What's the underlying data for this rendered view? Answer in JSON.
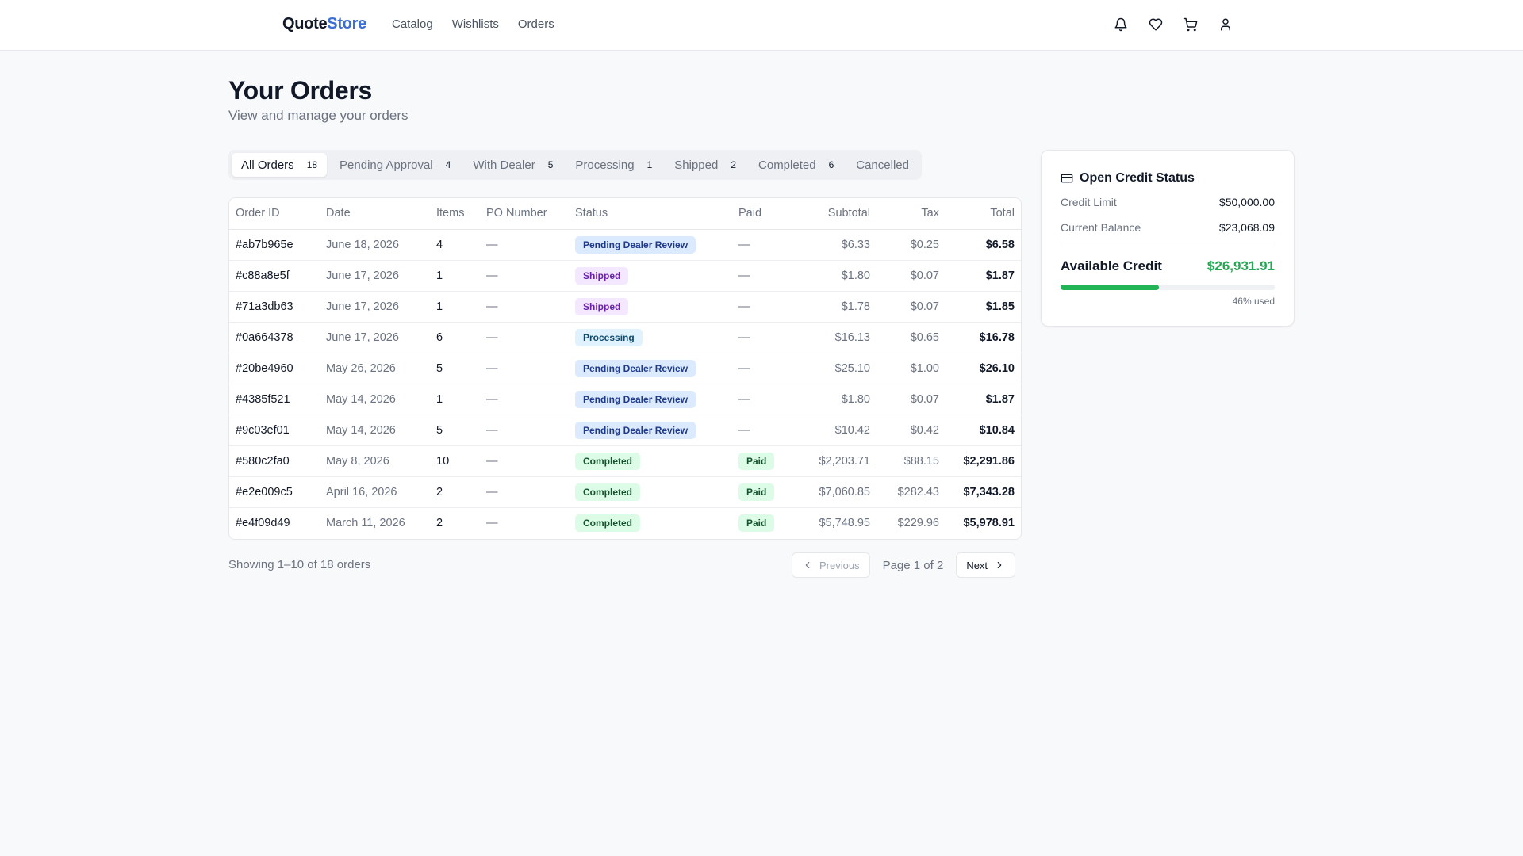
{
  "header": {
    "brand_part1": "Quote",
    "brand_part2": "Store",
    "nav": [
      "Catalog",
      "Wishlists",
      "Orders"
    ],
    "icons": [
      "bell-icon",
      "heart-icon",
      "cart-icon",
      "user-icon"
    ]
  },
  "page": {
    "title": "Your Orders",
    "subtitle": "View and manage your orders"
  },
  "tabs": [
    {
      "label": "All Orders",
      "count": "18",
      "active": true
    },
    {
      "label": "Pending Approval",
      "count": "4"
    },
    {
      "label": "With Dealer",
      "count": "5"
    },
    {
      "label": "Processing",
      "count": "1"
    },
    {
      "label": "Shipped",
      "count": "2"
    },
    {
      "label": "Completed",
      "count": "6"
    },
    {
      "label": "Cancelled",
      "count": ""
    }
  ],
  "table": {
    "columns": [
      "Order ID",
      "Date",
      "Items",
      "PO Number",
      "Status",
      "Paid",
      "Subtotal",
      "Tax",
      "Total"
    ],
    "rows": [
      {
        "id": "#ab7b965e",
        "date": "June 18, 2026",
        "items": "4",
        "po": "—",
        "status": "Pending Dealer Review",
        "status_kind": "pending",
        "paid": "—",
        "subtotal": "$6.33",
        "tax": "$0.25",
        "total": "$6.58"
      },
      {
        "id": "#c88a8e5f",
        "date": "June 17, 2026",
        "items": "1",
        "po": "—",
        "status": "Shipped",
        "status_kind": "shipped",
        "paid": "—",
        "subtotal": "$1.80",
        "tax": "$0.07",
        "total": "$1.87"
      },
      {
        "id": "#71a3db63",
        "date": "June 17, 2026",
        "items": "1",
        "po": "—",
        "status": "Shipped",
        "status_kind": "shipped",
        "paid": "—",
        "subtotal": "$1.78",
        "tax": "$0.07",
        "total": "$1.85"
      },
      {
        "id": "#0a664378",
        "date": "June 17, 2026",
        "items": "6",
        "po": "—",
        "status": "Processing",
        "status_kind": "processing",
        "paid": "—",
        "subtotal": "$16.13",
        "tax": "$0.65",
        "total": "$16.78"
      },
      {
        "id": "#20be4960",
        "date": "May 26, 2026",
        "items": "5",
        "po": "—",
        "status": "Pending Dealer Review",
        "status_kind": "pending",
        "paid": "—",
        "subtotal": "$25.10",
        "tax": "$1.00",
        "total": "$26.10"
      },
      {
        "id": "#4385f521",
        "date": "May 14, 2026",
        "items": "1",
        "po": "—",
        "status": "Pending Dealer Review",
        "status_kind": "pending",
        "paid": "—",
        "subtotal": "$1.80",
        "tax": "$0.07",
        "total": "$1.87"
      },
      {
        "id": "#9c03ef01",
        "date": "May 14, 2026",
        "items": "5",
        "po": "—",
        "status": "Pending Dealer Review",
        "status_kind": "pending",
        "paid": "—",
        "subtotal": "$10.42",
        "tax": "$0.42",
        "total": "$10.84"
      },
      {
        "id": "#580c2fa0",
        "date": "May 8, 2026",
        "items": "10",
        "po": "—",
        "status": "Completed",
        "status_kind": "completed",
        "paid": "Paid",
        "subtotal": "$2,203.71",
        "tax": "$88.15",
        "total": "$2,291.86"
      },
      {
        "id": "#e2e009c5",
        "date": "April 16, 2026",
        "items": "2",
        "po": "—",
        "status": "Completed",
        "status_kind": "completed",
        "paid": "Paid",
        "subtotal": "$7,060.85",
        "tax": "$282.43",
        "total": "$7,343.28"
      },
      {
        "id": "#e4f09d49",
        "date": "March 11, 2026",
        "items": "2",
        "po": "—",
        "status": "Completed",
        "status_kind": "completed",
        "paid": "Paid",
        "subtotal": "$5,748.95",
        "tax": "$229.96",
        "total": "$5,978.91"
      }
    ]
  },
  "pagination": {
    "showing": "Showing 1–10 of 18 orders",
    "previous": "Previous",
    "page_info": "Page 1 of 2",
    "next": "Next"
  },
  "credit": {
    "title": "Open Credit Status",
    "credit_limit_label": "Credit Limit",
    "credit_limit": "$50,000.00",
    "current_balance_label": "Current Balance",
    "current_balance": "$23,068.09",
    "available_label": "Available Credit",
    "available": "$26,931.91",
    "used_fraction": 0.46,
    "used_text": "46% used",
    "accent_color": "#22b356"
  }
}
